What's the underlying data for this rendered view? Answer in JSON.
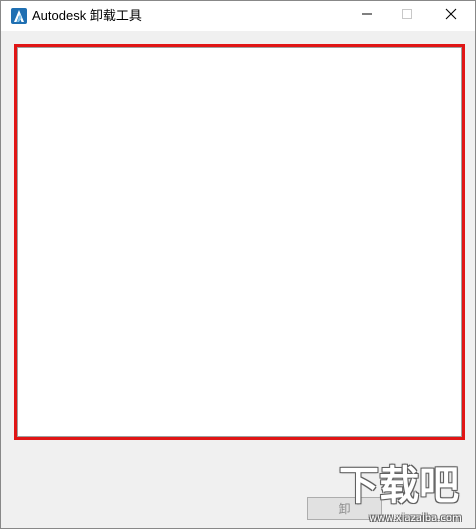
{
  "window": {
    "title": "Autodesk 卸载工具",
    "controls": {
      "minimize_icon": "minimize-icon",
      "maximize_icon": "maximize-icon",
      "close_icon": "close-icon"
    }
  },
  "content": {
    "highlight_color": "#e01515"
  },
  "bottom": {
    "button_label": "卸"
  },
  "watermark": {
    "text": "下载吧",
    "url": "www.xiazaiba.com"
  },
  "colors": {
    "app_icon": "#1f6fb2",
    "background": "#f0f0f0"
  }
}
